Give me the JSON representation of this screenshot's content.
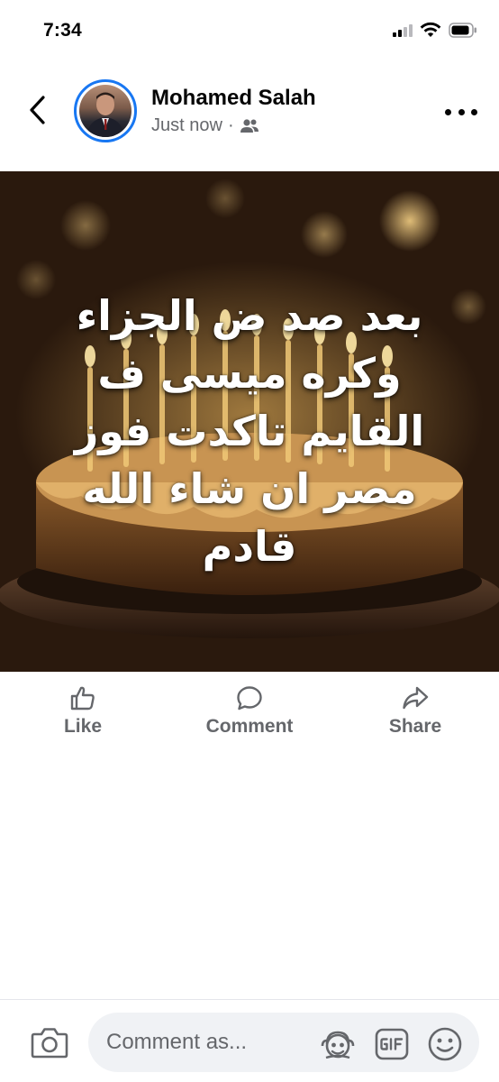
{
  "status_bar": {
    "time": "7:34"
  },
  "post": {
    "author_name": "Mohamed Salah",
    "timestamp": "Just now",
    "separator": "·",
    "audience_icon": "friends-icon",
    "text": "بعد صد ض الجزاء\nوكره ميسى ف\nالقايم تاكدت فوز\nمصر ان شاء الله\nقادم"
  },
  "actions": {
    "like_label": "Like",
    "comment_label": "Comment",
    "share_label": "Share"
  },
  "composer": {
    "placeholder": "Comment as..."
  },
  "colors": {
    "accent": "#1877f2",
    "secondary_text": "#65676b",
    "input_bg": "#f0f2f5"
  }
}
